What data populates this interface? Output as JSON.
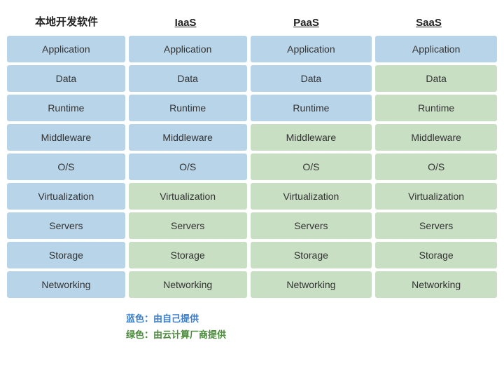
{
  "headers": {
    "col0": "本地开发软件",
    "col1": "IaaS",
    "col2": "PaaS",
    "col3": "SaaS"
  },
  "rows": [
    "Application",
    "Data",
    "Runtime",
    "Middleware",
    "O/S",
    "Virtualization",
    "Servers",
    "Storage",
    "Networking"
  ],
  "columns": {
    "col0_colors": [
      "blue",
      "blue",
      "blue",
      "blue",
      "blue",
      "blue",
      "blue",
      "blue",
      "blue"
    ],
    "col1_colors": [
      "blue",
      "blue",
      "blue",
      "blue",
      "blue",
      "green",
      "green",
      "green",
      "green"
    ],
    "col2_colors": [
      "blue",
      "blue",
      "blue",
      "green",
      "green",
      "green",
      "green",
      "green",
      "green"
    ],
    "col3_colors": [
      "blue",
      "green",
      "green",
      "green",
      "green",
      "green",
      "green",
      "green",
      "green"
    ]
  },
  "legend": {
    "blue_label": "蓝色：由自己提供",
    "green_label": "绿色：由云计算厂商提供"
  }
}
